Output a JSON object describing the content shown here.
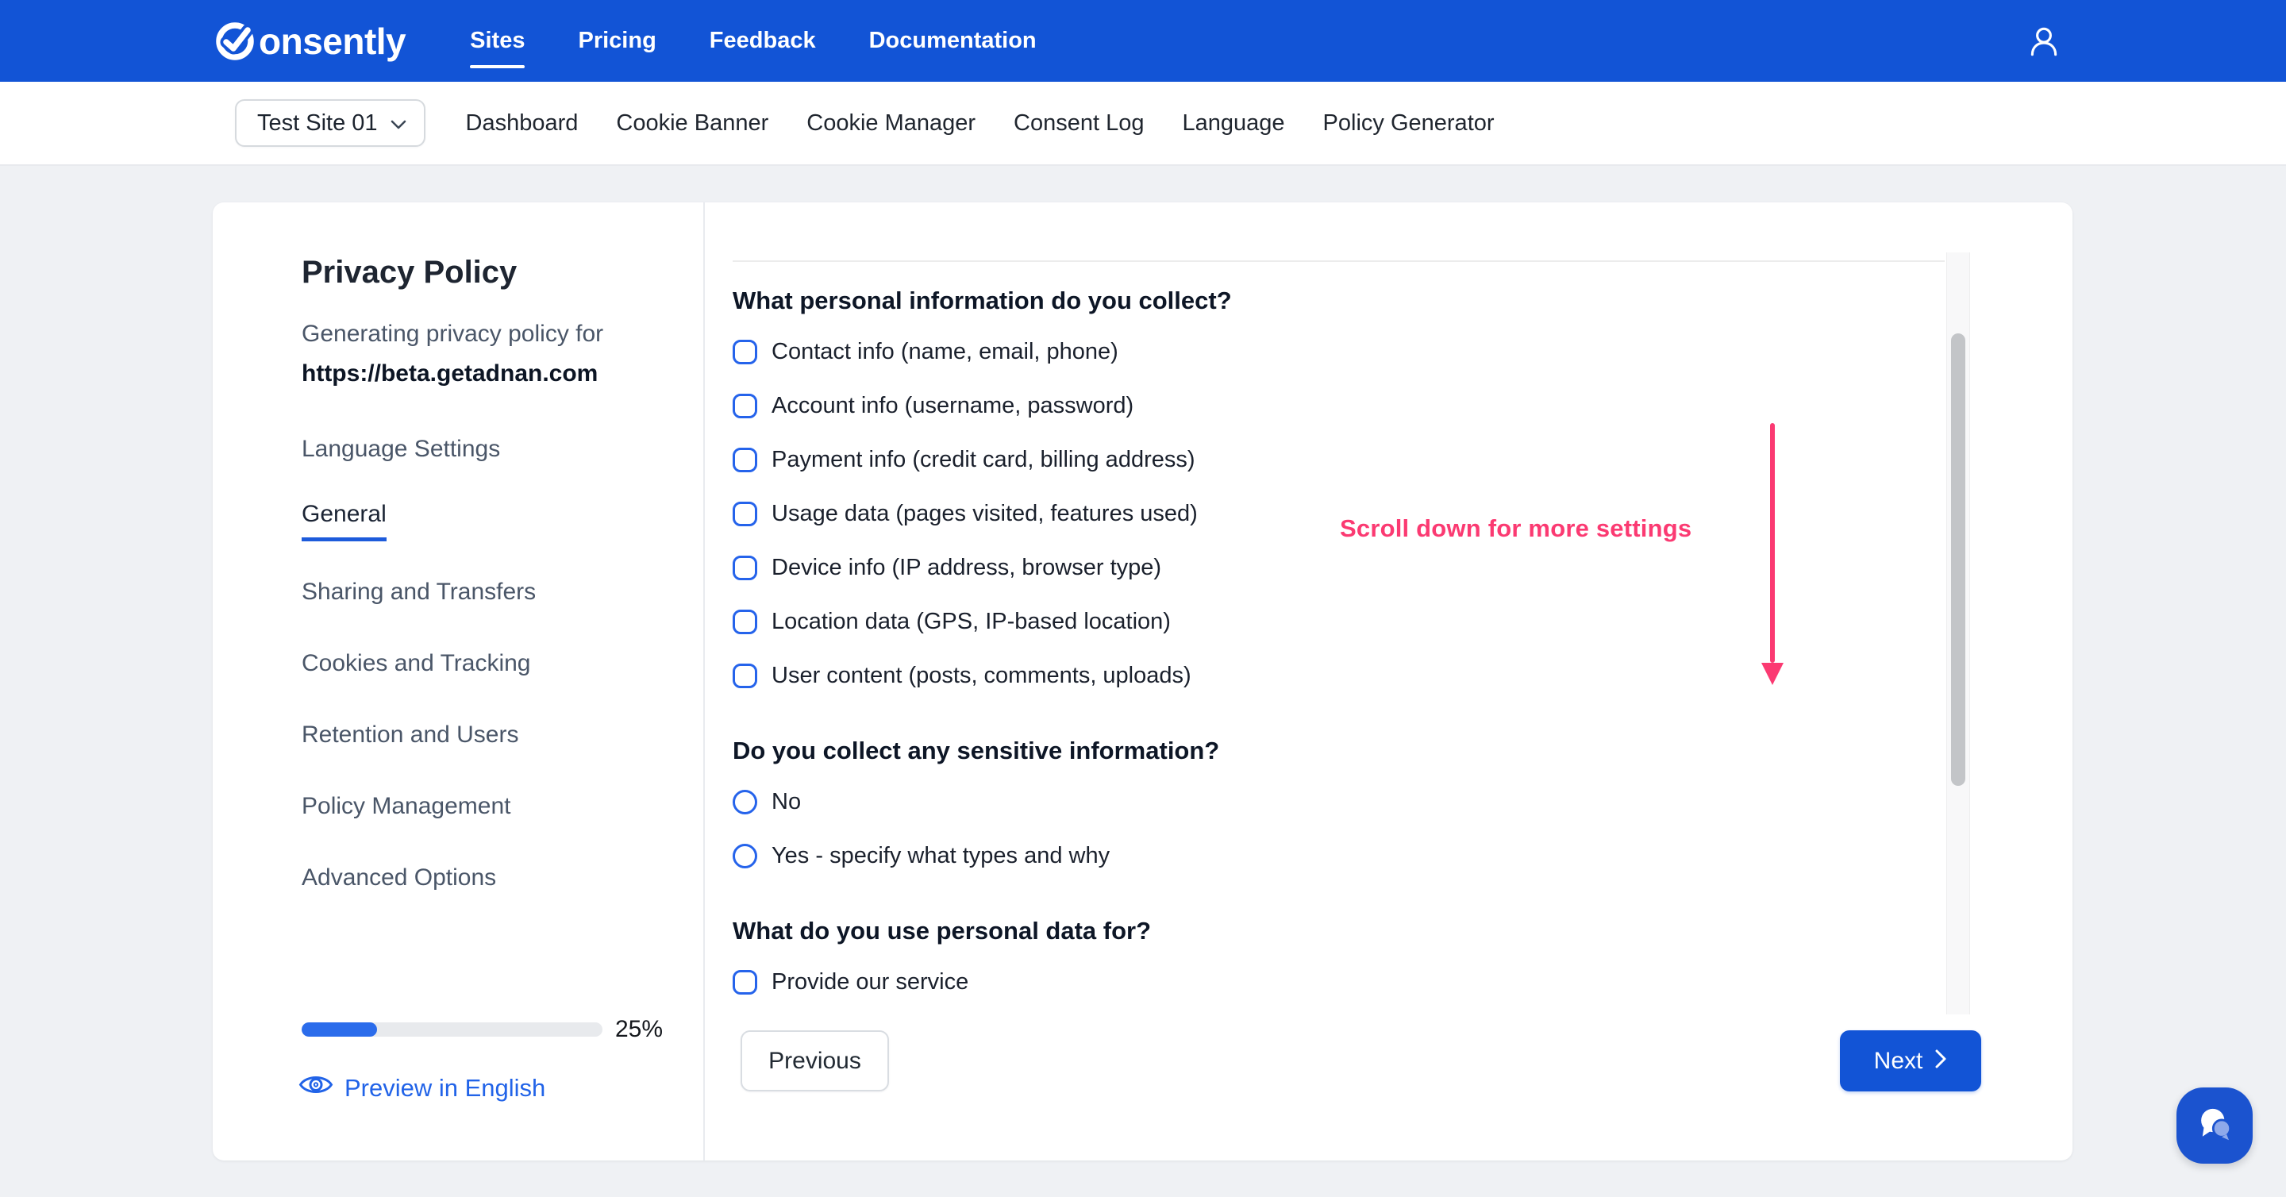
{
  "header": {
    "brand": "Consently",
    "brand_rest": "onsently",
    "nav": [
      {
        "label": "Sites",
        "active": true
      },
      {
        "label": "Pricing",
        "active": false
      },
      {
        "label": "Feedback",
        "active": false
      },
      {
        "label": "Documentation",
        "active": false
      }
    ]
  },
  "site_bar": {
    "site_selector": "Test Site 01",
    "tabs": [
      {
        "label": "Dashboard"
      },
      {
        "label": "Cookie Banner"
      },
      {
        "label": "Cookie Manager"
      },
      {
        "label": "Consent Log"
      },
      {
        "label": "Language"
      },
      {
        "label": "Policy Generator"
      }
    ]
  },
  "sidebar": {
    "title": "Privacy Policy",
    "subtitle": "Generating privacy policy for",
    "site_url": "https://beta.getadnan.com",
    "items": [
      {
        "label": "Language Settings",
        "active": false
      },
      {
        "label": "General",
        "active": true
      },
      {
        "label": "Sharing and Transfers",
        "active": false
      },
      {
        "label": "Cookies and Tracking",
        "active": false
      },
      {
        "label": "Retention and Users",
        "active": false
      },
      {
        "label": "Policy Management",
        "active": false
      },
      {
        "label": "Advanced Options",
        "active": false
      }
    ],
    "progress_percent": 25,
    "progress_label": "25%",
    "preview_link": "Preview in English"
  },
  "form": {
    "questions": [
      {
        "heading": "What personal information do you collect?",
        "type": "checkbox",
        "options": [
          "Contact info (name, email, phone)",
          "Account info (username, password)",
          "Payment info (credit card, billing address)",
          "Usage data (pages visited, features used)",
          "Device info (IP address, browser type)",
          "Location data (GPS, IP-based location)",
          "User content (posts, comments, uploads)"
        ]
      },
      {
        "heading": "Do you collect any sensitive information?",
        "type": "radio",
        "options": [
          "No",
          "Yes - specify what types and why"
        ]
      },
      {
        "heading": "What do you use personal data for?",
        "type": "checkbox",
        "options": [
          "Provide our service"
        ]
      }
    ],
    "previous_label": "Previous",
    "next_label": "Next"
  },
  "annotation": {
    "text": "Scroll down for more settings"
  },
  "icons": {
    "logo": "consently-ring-check-icon",
    "user": "user-icon",
    "site_selector": "chevron-down-icon",
    "next": "chevron-right-icon",
    "preview": "eye-icon",
    "chat": "chat-bubble-icon"
  },
  "colors": {
    "header_blue": "#1254d6",
    "accent_blue": "#2563eb",
    "link_blue": "#2163e8",
    "progress_blue": "#2b6ceb",
    "annotation_pink": "#fb3a72",
    "page_bg": "#eff1f4",
    "card_bg": "#ffffff"
  }
}
